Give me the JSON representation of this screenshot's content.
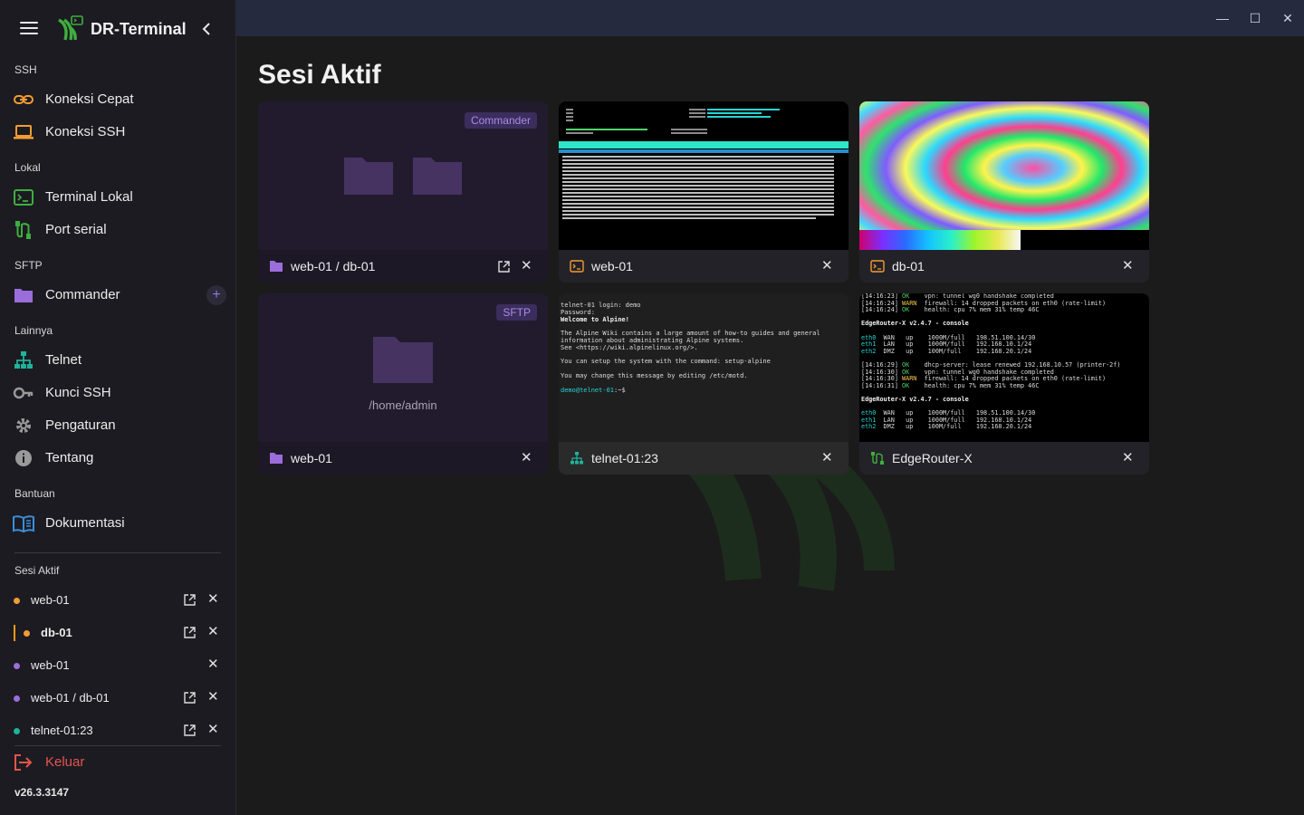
{
  "app": {
    "title": "DR-Terminal",
    "version": "v26.3.3147"
  },
  "sidebar": {
    "sections": {
      "ssh": "SSH",
      "lokal": "Lokal",
      "sftp": "SFTP",
      "lainnya": "Lainnya",
      "bantuan": "Bantuan",
      "sesi_aktif": "Sesi Aktif"
    },
    "items": {
      "koneksi_cepat": "Koneksi Cepat",
      "koneksi_ssh": "Koneksi SSH",
      "terminal_lokal": "Terminal Lokal",
      "port_serial": "Port serial",
      "commander": "Commander",
      "telnet": "Telnet",
      "kunci_ssh": "Kunci SSH",
      "pengaturan": "Pengaturan",
      "tentang": "Tentang",
      "dokumentasi": "Dokumentasi"
    },
    "sessions": [
      {
        "label": "web-01",
        "color": "#f39c34"
      },
      {
        "label": "db-01",
        "color": "#f39c34",
        "active": true
      },
      {
        "label": "web-01",
        "color": "#9b6ddb"
      },
      {
        "label": "web-01 / db-01",
        "color": "#9b6ddb"
      },
      {
        "label": "telnet-01:23",
        "color": "#1fb39a"
      }
    ],
    "logout": "Keluar"
  },
  "main": {
    "title": "Sesi Aktif",
    "cards": [
      {
        "label": "web-01 / db-01",
        "tag": "Commander",
        "type": "sftp"
      },
      {
        "label": "web-01",
        "type": "ssh"
      },
      {
        "label": "db-01",
        "type": "ssh"
      },
      {
        "label": "web-01",
        "tag": "SFTP",
        "path": "/home/admin",
        "type": "sftp"
      },
      {
        "label": "telnet-01:23",
        "type": "telnet"
      },
      {
        "label": "EdgeRouter-X",
        "type": "serial"
      }
    ]
  },
  "colors": {
    "accent": "#f39c34",
    "sftp": "#9b6ddb",
    "telnet": "#1fb39a",
    "danger": "#e5544b",
    "logo": "#3fae3f"
  },
  "terminal": {
    "telnet_lines": [
      "telnet-01 login: demo",
      "Password:",
      "Welcome to Alpine!",
      "",
      "The Alpine Wiki contains a large amount of how-to guides and general",
      "information about administrating Alpine systems.",
      "See <https://wiki.alpinelinux.org/>.",
      "",
      "You can setup the system with the command: setup-alpine",
      "",
      "You may change this message by editing /etc/motd.",
      ""
    ],
    "telnet_prompt": "demo@telnet-01",
    "telnet_prompt_tail": ":~$",
    "router_lines": [
      "[14:16:23] OK    vpn: tunnel wg0 handshake completed",
      "[14:16:24] WARN  firewall: 14 dropped packets on eth0 (rate-limit)",
      "[14:16:24] OK    health: cpu 7% mem 31% temp 46C",
      "",
      "EdgeRouter-X v2.4.7 - console",
      "",
      "eth0  WAN   up    1000M/full   198.51.100.14/30",
      "eth1  LAN   up    1000M/full   192.168.10.1/24",
      "eth2  DMZ   up    100M/full    192.168.20.1/24",
      "",
      "[14:16:29] OK    dhcp-server: lease renewed 192.168.10.57 (printer-2f)",
      "[14:16:30] OK    vpn: tunnel wg0 handshake completed",
      "[14:16:30] WARN  firewall: 14 dropped packets on eth0 (rate-limit)",
      "[14:16:31] OK    health: cpu 7% mem 31% temp 46C",
      "",
      "EdgeRouter-X v2.4.7 - console",
      "",
      "eth0  WAN   up    1000M/full   198.51.100.14/30",
      "eth1  LAN   up    1000M/full   192.168.10.1/24",
      "eth2  DMZ   up    100M/full    192.168.20.1/24"
    ]
  }
}
